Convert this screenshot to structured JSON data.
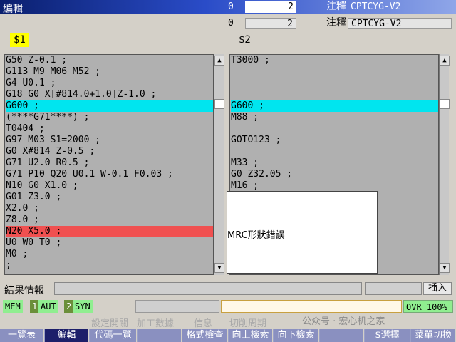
{
  "window": {
    "title": "編輯"
  },
  "top_counters": {
    "row1": {
      "left": "0",
      "right": "2",
      "note_label": "注釋",
      "note_value": "CPTCYG-V2"
    },
    "row2": {
      "left": "0",
      "right": "2",
      "note_label": "注釋",
      "note_value": "CPTCYG-V2"
    }
  },
  "channels": {
    "left": "$1",
    "right": "$2"
  },
  "left_program": {
    "lines": [
      "G50 Z-0.1 ;",
      "G113 M9 M06 M52 ;",
      "G4 U0.1 ;",
      "G18 G0 X[#814.0+1.0]Z-1.0 ;",
      "G600 ;",
      "(****G71****) ;",
      "T0404 ;",
      "G97 M03 S1=2000 ;",
      "G0 X#814 Z-0.5 ;",
      "G71 U2.0 R0.5 ;",
      "G71 P10 Q20 U0.1 W-0.1 F0.03 ;",
      "N10 G0 X1.0 ;",
      "G01 Z3.0 ;",
      "X2.0 ;",
      "Z8.0 ;",
      "N20 X5.0 ;",
      "U0 W0 T0 ;",
      "M0 ;",
      ";"
    ]
  },
  "right_program": {
    "lines": [
      "T3000 ;",
      "",
      "",
      "",
      "G600 ;",
      "M88 ;",
      "",
      "GOTO123 ;",
      "",
      "M33 ;",
      "G0 Z32.05 ;",
      "M16 ;"
    ]
  },
  "colors": {
    "highlight_sync": "#00e5ef",
    "highlight_error": "#f05050",
    "status_green": "#90ee90",
    "softkey_active": "#1d1f6a",
    "softkey": "#8a90c0",
    "title_dark": "#0a1f6e"
  },
  "popup": {
    "message": "MRC形狀錯誤"
  },
  "result": {
    "label": "結果情報",
    "insert_label": "插入"
  },
  "status": {
    "mem": "MEM",
    "ch1_num": "1",
    "ch1_mode": "AUT",
    "ch2_num": "2",
    "ch2_mode": "SYN",
    "override": "OVR 100%"
  },
  "menu_hints": [
    "設定開關",
    "加工數據",
    "信息",
    "切削周期"
  ],
  "watermark": "公众号 · 宏心机之家",
  "softkeys": [
    "一覽表",
    "編輯",
    "代碼一覽",
    "",
    "格式檢查",
    "向上檢索",
    "向下檢索",
    "",
    "$選擇",
    "菜單切換"
  ]
}
